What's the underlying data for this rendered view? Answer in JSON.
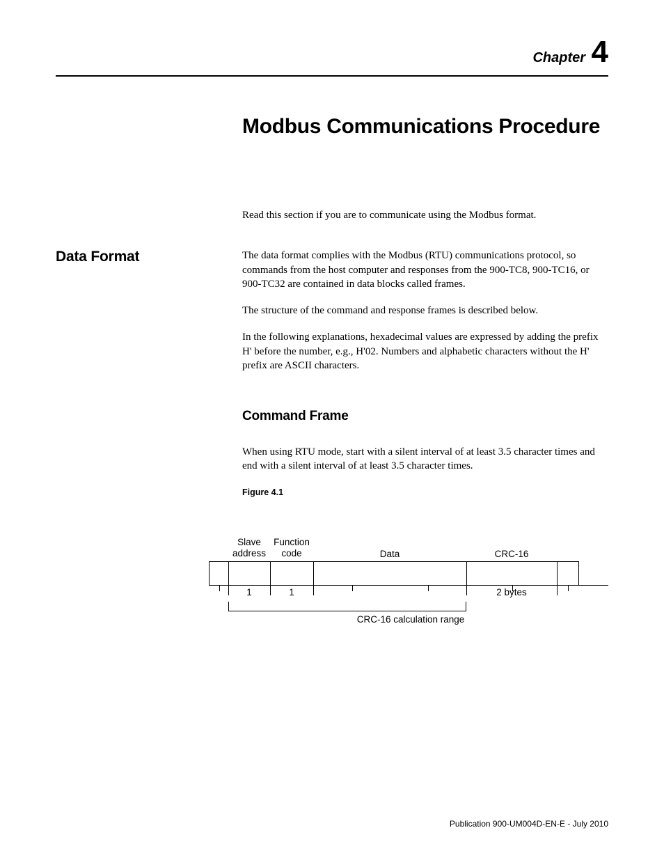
{
  "chapter": {
    "label": "Chapter",
    "number": "4",
    "title": "Modbus Communications Procedure"
  },
  "intro": "Read this section if you are to communicate using the Modbus format.",
  "sections": {
    "data_format": {
      "heading": "Data Format",
      "paragraphs": [
        "The data format complies with the Modbus (RTU) communications protocol, so commands from the host computer and responses from the 900-TC8, 900-TC16, or 900-TC32 are contained in data blocks called frames.",
        "The structure of the command and response frames is described below.",
        "In the following explanations, hexadecimal values are expressed by adding the prefix H' before the number, e.g., H'02. Numbers and alphabetic characters without the H' prefix are ASCII characters."
      ],
      "subsection": {
        "heading": "Command Frame",
        "paragraph": "When using RTU mode, start with a silent interval of at least 3.5 character times and end with a silent interval of at least 3.5 character times.",
        "figure_label": "Figure 4.1",
        "diagram": {
          "top_labels": {
            "slave": "Slave address",
            "function": "Function code",
            "data": "Data",
            "crc": "CRC-16"
          },
          "bottom_labels": {
            "slave_bytes": "1",
            "function_bytes": "1",
            "crc_bytes": "2 bytes"
          },
          "crc_range": "CRC-16 calculation range"
        }
      }
    }
  },
  "footer": "Publication 900-UM004D-EN-E - July 2010"
}
